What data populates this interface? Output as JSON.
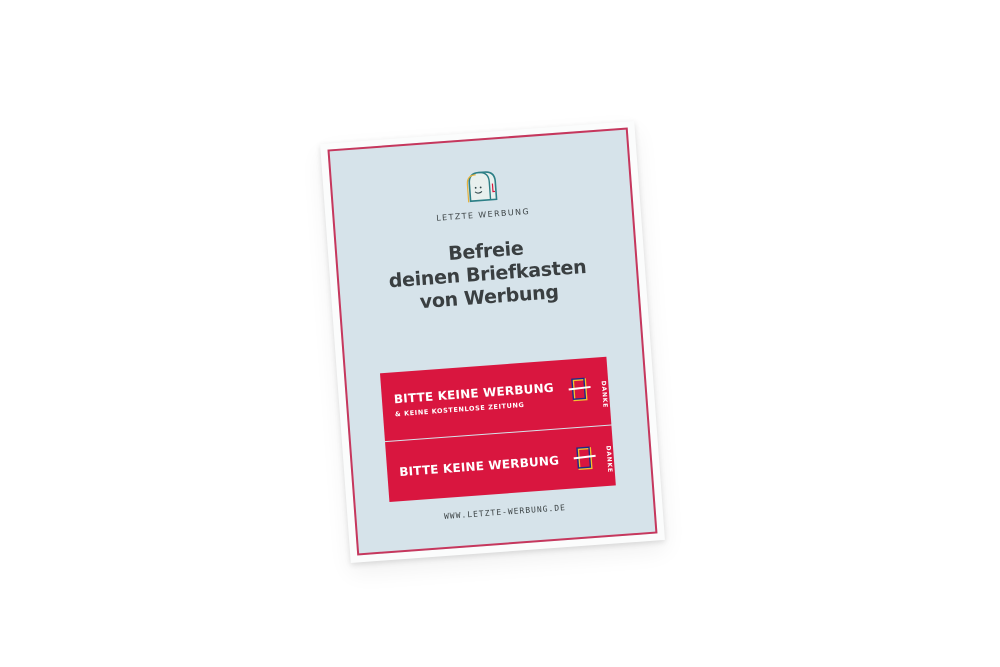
{
  "brand": {
    "name": "LETZTE WERBUNG",
    "logo_icon": "smiling-mailbox-icon"
  },
  "headline": {
    "line1": "Befreie",
    "line2": "deinen Briefkasten",
    "line3": "von Werbung"
  },
  "stickers": [
    {
      "title": "BITTE KEINE WERBUNG",
      "subtitle": "& KEINE KOSTENLOSE ZEITUNG",
      "side_text": "DANKE",
      "icon": "crossed-mailbox-icon"
    },
    {
      "title": "BITTE KEINE WERBUNG",
      "side_text": "DANKE",
      "icon": "crossed-mailbox-icon"
    }
  ],
  "footer": {
    "url": "WWW.LETZTE-WERBUNG.DE"
  },
  "colors": {
    "card_background": "#d6e3ea",
    "border_accent": "#c6375d",
    "sticker_red": "#d9163f",
    "text_dark": "#3a3f41"
  }
}
